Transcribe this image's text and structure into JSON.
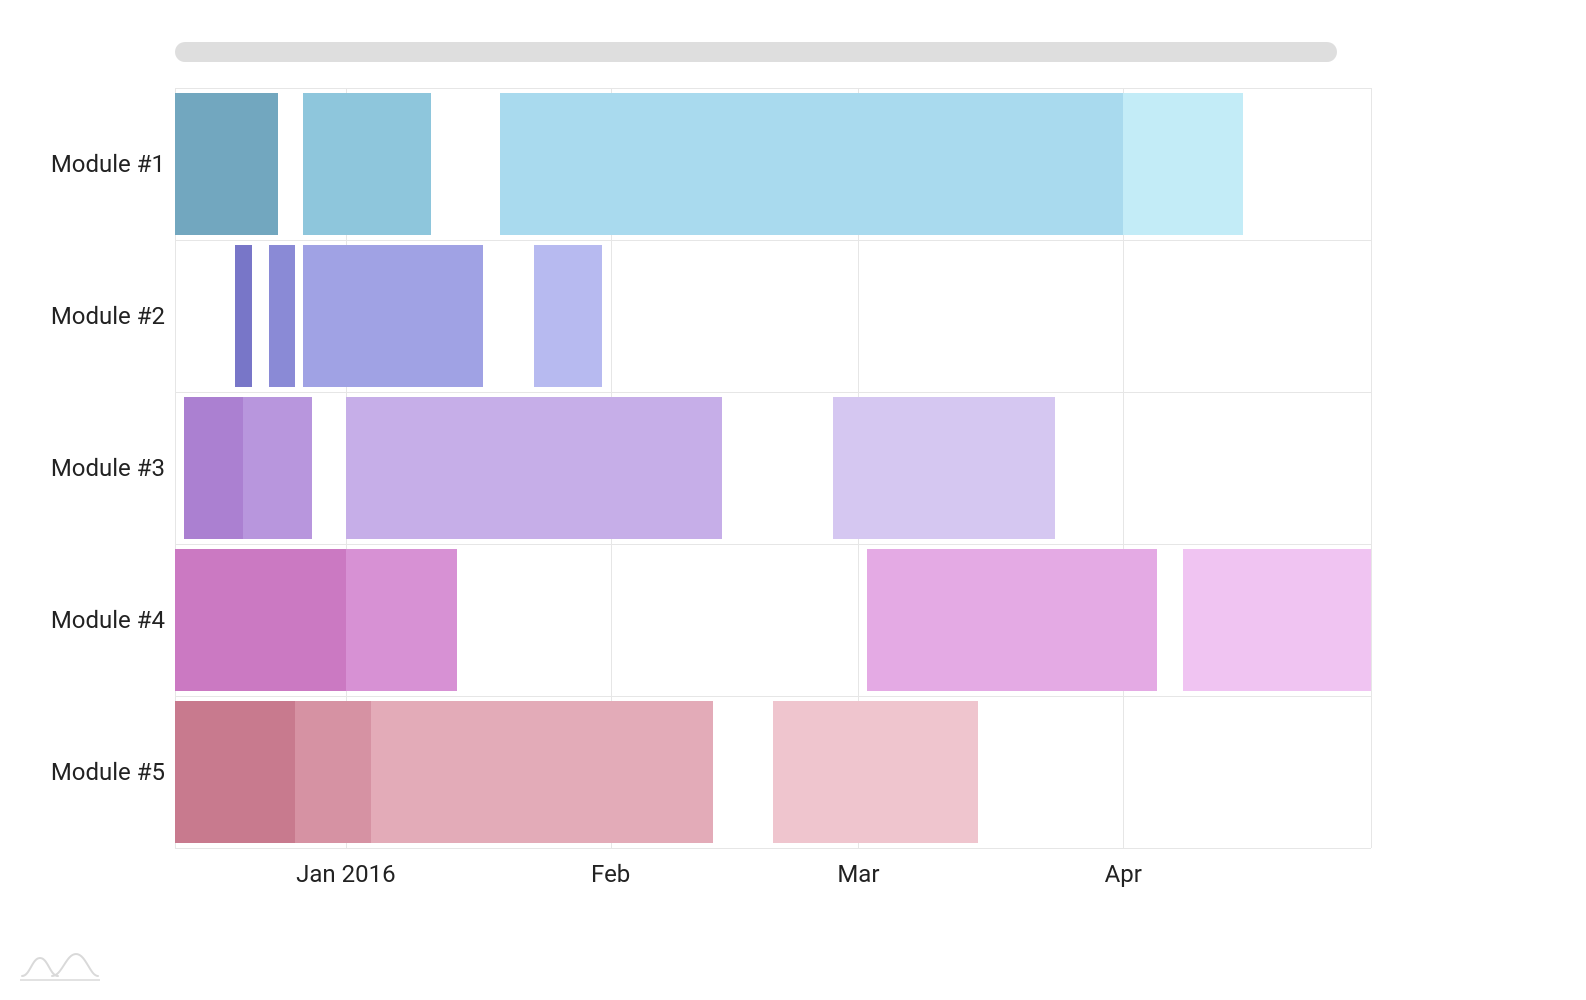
{
  "chart_data": {
    "type": "gantt",
    "x_axis": {
      "unit": "date",
      "range_start": "2015-12-12",
      "range_end": "2016-04-30",
      "ticks": [
        {
          "label": "Jan 2016",
          "date": "2016-01-01"
        },
        {
          "label": "Feb",
          "date": "2016-02-01"
        },
        {
          "label": "Mar",
          "date": "2016-03-01"
        },
        {
          "label": "Apr",
          "date": "2016-04-01"
        }
      ]
    },
    "categories": [
      "Module #1",
      "Module #2",
      "Module #3",
      "Module #4",
      "Module #5"
    ],
    "series": [
      {
        "name": "Module #1",
        "segments": [
          {
            "start": "2015-12-12",
            "end": "2015-12-24",
            "color": "#72a7bf"
          },
          {
            "start": "2015-12-27",
            "end": "2016-01-11",
            "color": "#8ec6dc"
          },
          {
            "start": "2016-01-19",
            "end": "2016-04-01",
            "color": "#a9daee"
          },
          {
            "start": "2016-04-01",
            "end": "2016-04-15",
            "color": "#c3ecf7"
          }
        ]
      },
      {
        "name": "Module #2",
        "segments": [
          {
            "start": "2015-12-19",
            "end": "2015-12-21",
            "color": "#7876c8"
          },
          {
            "start": "2015-12-23",
            "end": "2015-12-26",
            "color": "#8a8ad6"
          },
          {
            "start": "2015-12-27",
            "end": "2016-01-17",
            "color": "#a0a2e4"
          },
          {
            "start": "2016-01-23",
            "end": "2016-01-31",
            "color": "#b7baf0"
          }
        ]
      },
      {
        "name": "Module #3",
        "segments": [
          {
            "start": "2015-12-13",
            "end": "2015-12-20",
            "color": "#ab80d1"
          },
          {
            "start": "2015-12-20",
            "end": "2015-12-28",
            "color": "#b896dd"
          },
          {
            "start": "2016-01-01",
            "end": "2016-02-14",
            "color": "#c6aee8"
          },
          {
            "start": "2016-02-27",
            "end": "2016-03-24",
            "color": "#d5c7f1"
          }
        ]
      },
      {
        "name": "Module #4",
        "segments": [
          {
            "start": "2015-12-12",
            "end": "2016-01-01",
            "color": "#cb79c2"
          },
          {
            "start": "2016-01-01",
            "end": "2016-01-14",
            "color": "#d791d4"
          },
          {
            "start": "2016-03-02",
            "end": "2016-04-05",
            "color": "#e4aae4"
          },
          {
            "start": "2016-04-08",
            "end": "2016-04-30",
            "color": "#f0c4f2"
          }
        ]
      },
      {
        "name": "Module #5",
        "segments": [
          {
            "start": "2015-12-12",
            "end": "2015-12-26",
            "color": "#c87a8e"
          },
          {
            "start": "2015-12-26",
            "end": "2016-01-04",
            "color": "#d692a3"
          },
          {
            "start": "2016-01-04",
            "end": "2016-02-13",
            "color": "#e3abb8"
          },
          {
            "start": "2016-02-20",
            "end": "2016-03-15",
            "color": "#efc5ce"
          }
        ]
      }
    ]
  },
  "ui": {
    "scrollbar_color": "#dedede",
    "grid_color": "#e6e6e6"
  }
}
